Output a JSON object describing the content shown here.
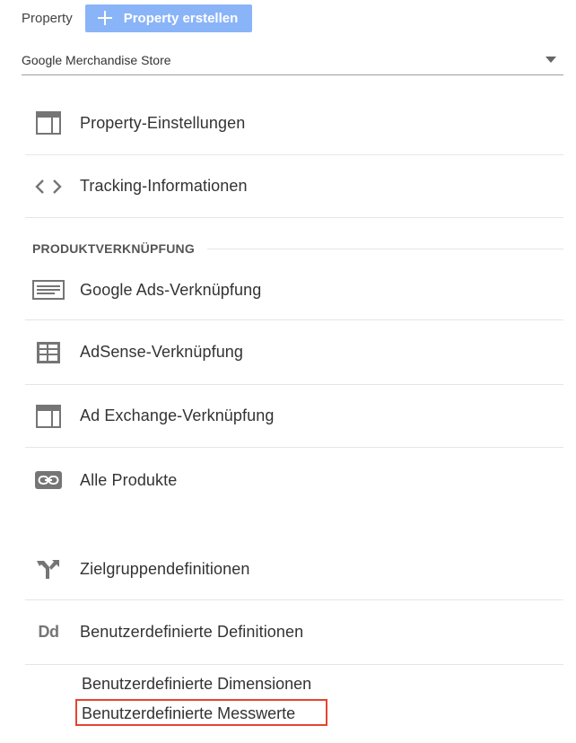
{
  "header": {
    "label": "Property",
    "create_button": {
      "label": "Property erstellen",
      "icon": "plus-icon"
    }
  },
  "property_selector": {
    "value": "Google Merchandise Store",
    "icon": "dropdown-caret-icon"
  },
  "menu": {
    "property_settings": {
      "label": "Property-Einstellungen",
      "icon": "property-settings-icon"
    },
    "tracking_info": {
      "label": "Tracking-Informationen",
      "icon": "code-brackets-icon"
    }
  },
  "product_linking": {
    "title": "PRODUKTVERKNÜPFUNG",
    "items": [
      {
        "label": "Google Ads-Verknüpfung",
        "icon": "google-ads-icon"
      },
      {
        "label": "AdSense-Verknüpfung",
        "icon": "adsense-icon"
      },
      {
        "label": "Ad Exchange-Verknüpfung",
        "icon": "ad-exchange-icon"
      },
      {
        "label": "Alle Produkte",
        "icon": "link-icon"
      }
    ]
  },
  "other": {
    "audience_definitions": {
      "label": "Zielgruppendefinitionen",
      "icon": "audience-fork-icon"
    },
    "custom_definitions": {
      "label": "Benutzerdefinierte Definitionen",
      "icon": "dd-icon",
      "icon_text": "Dd",
      "subitems": [
        {
          "label": "Benutzerdefinierte Dimensionen"
        },
        {
          "label": "Benutzerdefinierte Messwerte",
          "highlighted": true
        }
      ]
    }
  },
  "colors": {
    "create_button_bg": "#8ab4f8",
    "highlight_border": "#e4452f",
    "icon_gray": "#757575"
  }
}
